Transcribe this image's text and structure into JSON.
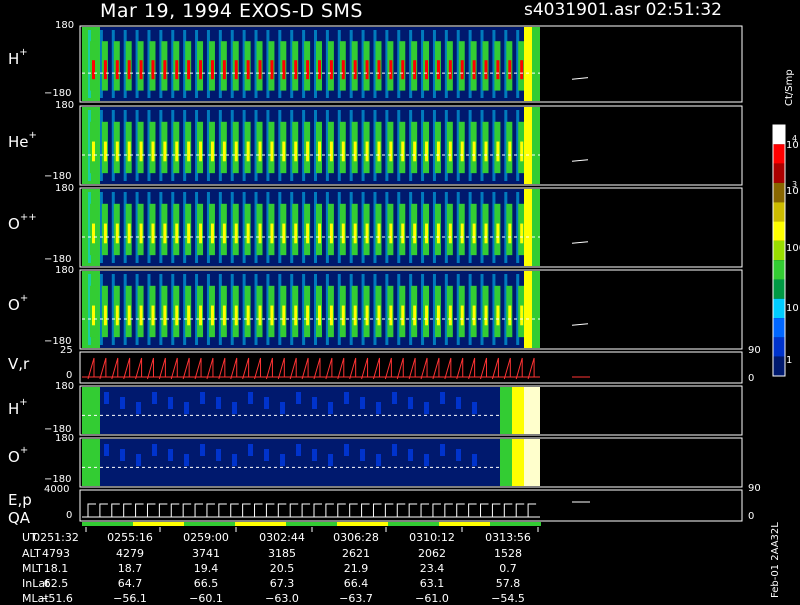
{
  "header": {
    "title": "Mar 19, 1994   EXOS-D SMS",
    "file": "s4031901.asr  02:51:32"
  },
  "colorbar": {
    "unit": "Ct/Smp",
    "ticks": [
      "1",
      "10",
      "100",
      "10",
      "3",
      "10",
      "4"
    ]
  },
  "colors": {
    "background": "#000000",
    "spectrogram_bg": "#00196e",
    "low": "#0033cc",
    "mid": "#00ccff",
    "green": "#33cc33",
    "yellow": "#ffff00",
    "high": "#ff0000",
    "orange_line": "#ff3333"
  },
  "chart_data": [
    {
      "type": "heatmap",
      "ion": "H+",
      "label": "H",
      "sup": "+",
      "yticks": [
        "180",
        "−180"
      ],
      "peak": "red"
    },
    {
      "type": "heatmap",
      "ion": "He+",
      "label": "He",
      "sup": "+",
      "yticks": [
        "180",
        "−180"
      ],
      "peak": "yellow"
    },
    {
      "type": "heatmap",
      "ion": "O++",
      "label": "O",
      "sup": "++",
      "yticks": [
        "180",
        "−180"
      ],
      "peak": "yellow"
    },
    {
      "type": "heatmap",
      "ion": "O+",
      "label": "O",
      "sup": "+",
      "yticks": [
        "180",
        "−180"
      ],
      "peak": "yellow"
    },
    {
      "type": "line",
      "label": "V,r",
      "yticks": [
        "25",
        "0"
      ],
      "right_ticks": [
        "90",
        "0"
      ]
    },
    {
      "type": "heatmap",
      "ion": "H+",
      "label": "H",
      "sup": "+",
      "yticks": [
        "180",
        "−180"
      ]
    },
    {
      "type": "heatmap",
      "ion": "O+",
      "label": "O",
      "sup": "+",
      "yticks": [
        "180",
        "−180"
      ]
    },
    {
      "type": "line",
      "label": "E,p",
      "label2": "QA",
      "yticks": [
        "4000",
        "0"
      ],
      "right_ticks": [
        "90",
        "0"
      ]
    }
  ],
  "orbit_table": {
    "rows": [
      {
        "label": "UT",
        "values": [
          "0251:32",
          "0255:16",
          "0259:00",
          "0302:44",
          "0306:28",
          "0310:12",
          "0313:56"
        ]
      },
      {
        "label": "ALT",
        "values": [
          "4793",
          "4279",
          "3741",
          "3185",
          "2621",
          "2062",
          "1528"
        ]
      },
      {
        "label": "MLT",
        "values": [
          "18.1",
          "18.7",
          "19.4",
          "20.5",
          "21.9",
          "23.4",
          "0.7"
        ]
      },
      {
        "label": "InLat",
        "values": [
          "62.5",
          "64.7",
          "66.5",
          "67.3",
          "66.4",
          "63.1",
          "57.8"
        ]
      },
      {
        "label": "MLat",
        "values": [
          "−51.6",
          "−56.1",
          "−60.1",
          "−63.0",
          "−63.7",
          "−61.0",
          "−54.5"
        ]
      }
    ]
  },
  "footer": "Feb-01 2AA32L"
}
